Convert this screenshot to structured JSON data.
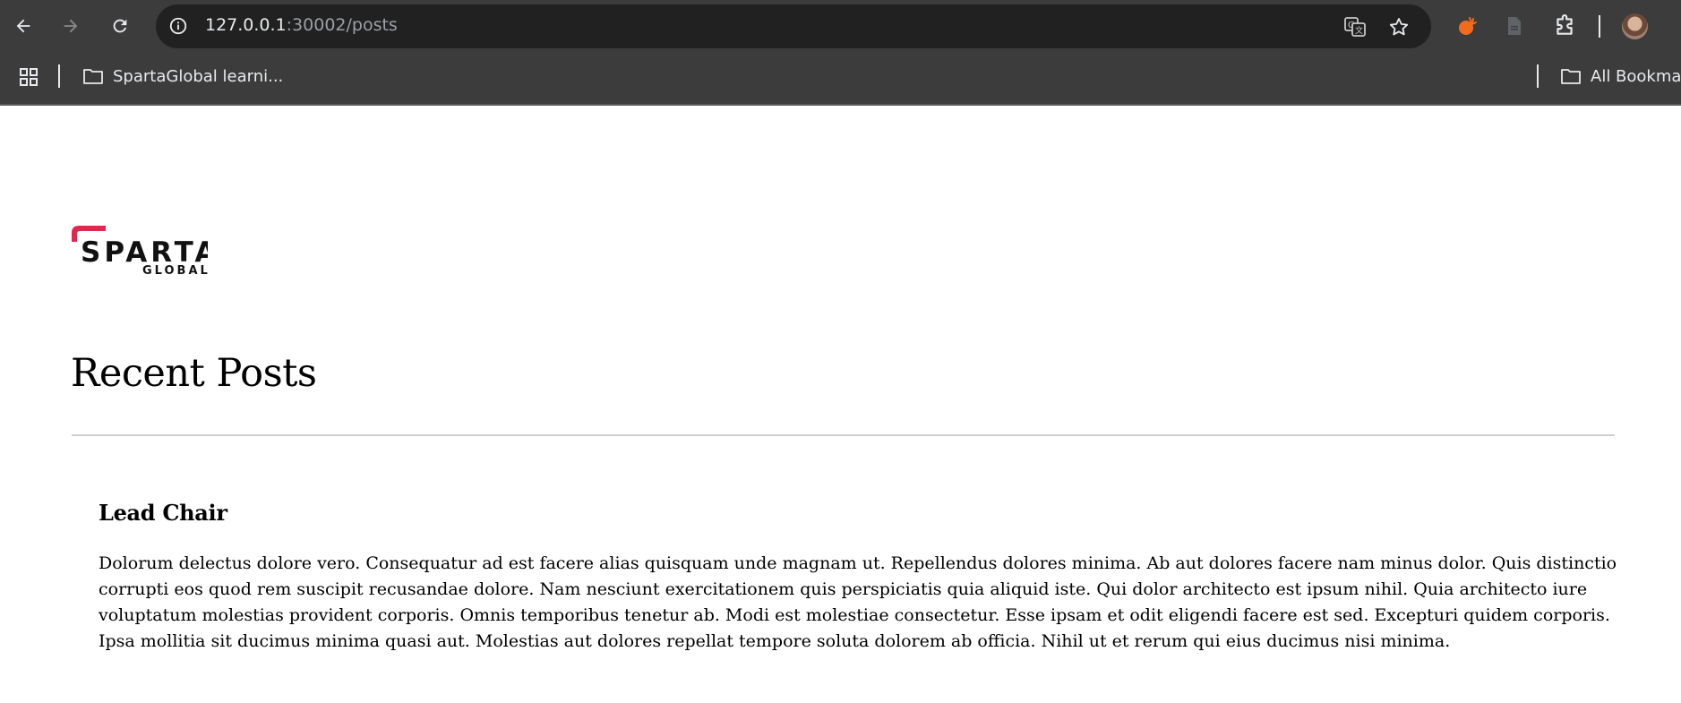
{
  "browser": {
    "url_host": "127.0.0.1",
    "url_rest": ":30002/posts",
    "icons": {
      "back": "back-arrow-icon",
      "forward": "forward-arrow-icon",
      "reload": "reload-icon",
      "info": "info-icon",
      "translate": "translate-icon",
      "bookmark_star": "star-icon",
      "extension_orange": "extension-icon",
      "extension_doc": "document-icon",
      "extensions_menu": "puzzle-icon",
      "profile": "avatar"
    },
    "bookmarks_bar": {
      "items": [
        {
          "label": "SpartaGlobal learni..."
        }
      ],
      "all_bookmarks_label": "All Bookmarks"
    }
  },
  "logo": {
    "line1": "SPARTA",
    "line2": "GLOBAL",
    "accent_color": "#e0284f"
  },
  "page": {
    "title": "Recent Posts"
  },
  "posts": [
    {
      "title": "Lead Chair",
      "body": "Dolorum delectus dolore vero. Consequatur ad est facere alias quisquam unde magnam ut. Repellendus dolores minima. Ab aut dolores facere nam minus dolor. Quis distinctio corrupti eos quod rem suscipit recusandae dolore. Nam nesciunt exercitationem quis perspiciatis quia aliquid iste. Qui dolor architecto est ipsum nihil. Quia architecto iure voluptatum molestias provident corporis. Omnis temporibus tenetur ab. Modi est molestiae consectetur. Esse ipsam et odit eligendi facere est sed. Excepturi quidem corporis. Ipsa mollitia sit ducimus minima quasi aut. Molestias aut dolores repellat tempore soluta dolorem ab officia. Nihil ut et rerum qui eius ducimus nisi minima."
    }
  ]
}
